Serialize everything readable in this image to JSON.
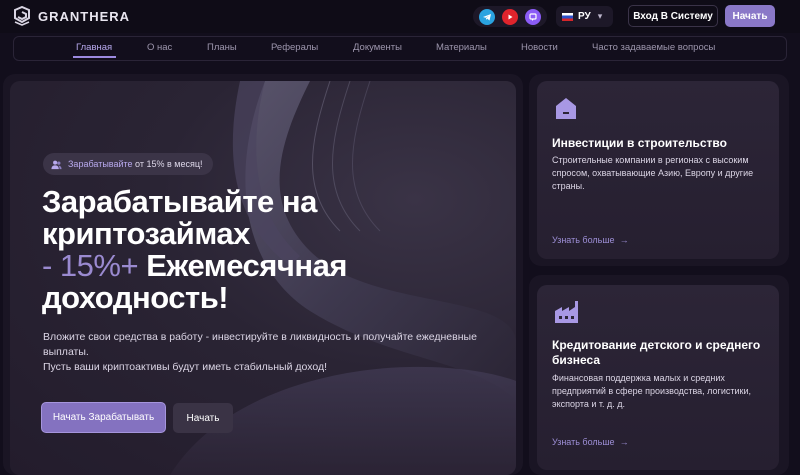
{
  "header": {
    "logo_text": "GRANTHERA",
    "socials": [
      {
        "icon": "telegram-icon",
        "color": "#2aa3e0"
      },
      {
        "icon": "youtube-icon",
        "color": "#e0242c"
      },
      {
        "icon": "twitch-icon",
        "color": "#8b5cf6"
      }
    ],
    "language": "РУ",
    "login_label": "Вход В Систему",
    "start_label": "Начать"
  },
  "nav": {
    "items": [
      "Главная",
      "О нас",
      "Планы",
      "Рефералы",
      "Документы",
      "Материалы",
      "Новости",
      "Часто задаваемые вопросы"
    ],
    "active": "Главная"
  },
  "hero": {
    "badge_highlight": "Зарабатывайте",
    "badge_rest": " от 15% в месяц!",
    "title_line1": "Зарабатывайте на",
    "title_line2": "криптозаймах",
    "title_accent": "- 15%+",
    "title_line3_rest": " Ежемесячная",
    "title_line4": "доходность!",
    "desc_line1": "Вложите свои средства в работу - инвестируйте в ликвидность и получайте ежедневные выплаты.",
    "desc_line2": "Пусть ваши криптоактивы будут иметь стабильный доход!",
    "cta_primary": "Начать Зарабатывать",
    "cta_secondary": "Начать"
  },
  "cards": [
    {
      "icon": "house-icon",
      "title": "Инвестиции в строительство",
      "text": "Строительные компании в регионах с высоким спросом, охватывающие Азию, Европу и другие страны.",
      "link": "Узнать больше"
    },
    {
      "icon": "factory-icon",
      "title": "Кредитование детского и среднего бизнеса",
      "text": "Финансовая поддержка малых и средних предприятий в сфере производства, логистики, экспорта и т. д. д.",
      "link": "Узнать больше"
    }
  ],
  "colors": {
    "accent": "#8a78c8",
    "background": "#120e1c",
    "card": "#2a2434"
  }
}
